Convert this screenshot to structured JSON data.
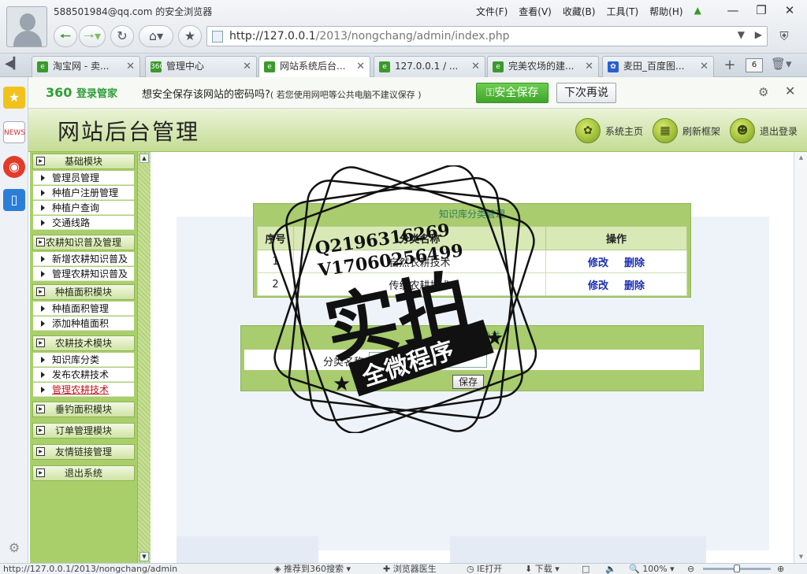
{
  "browser": {
    "profile_text": "588501984@qq.com 的安全浏览器",
    "menu": [
      "文件(F)",
      "查看(V)",
      "收藏(B)",
      "工具(T)",
      "帮助(H)"
    ],
    "url_host": "http://127.0.0.1",
    "url_path": "/2013/nongchang/admin/index.php",
    "tabs": [
      {
        "label": "淘宝网 - 卖...",
        "icon_color": "#3a9a2a",
        "active": false
      },
      {
        "label": "管理中心",
        "icon_color": "#3a9a2a",
        "icon_text": "360",
        "active": false
      },
      {
        "label": "网站系统后台...",
        "icon_color": "#3a9a2a",
        "active": true
      },
      {
        "label": "127.0.0.1 / ...",
        "icon_color": "#3a9a2a",
        "active": false
      },
      {
        "label": "完美农场的建...",
        "icon_color": "#3a9a2a",
        "active": false
      },
      {
        "label": "麦田_百度图...",
        "icon_color": "#2a5fd0",
        "active": false
      }
    ],
    "tab_count": "6"
  },
  "pwbar": {
    "brand": "360",
    "brand_suffix": "登录管家",
    "message": "想安全保存该网站的密码吗?",
    "note": "( 若您使用网吧等公共电脑不建议保存 )",
    "save_label": "安全保存",
    "later_label": "下次再说"
  },
  "admin": {
    "title": "网站后台管理",
    "links": [
      "系统主页",
      "刷新框架",
      "退出登录"
    ]
  },
  "menu": {
    "sections": [
      {
        "title": "基础模块",
        "items": [
          "管理员管理",
          "种植户注册管理",
          "种植户查询",
          "交通线路"
        ]
      },
      {
        "title": "农耕知识普及管理",
        "items": [
          "新增农耕知识普及",
          "管理农耕知识普及"
        ]
      },
      {
        "title": "种植面积模块",
        "items": [
          "种植面积管理",
          "添加种植面积"
        ]
      },
      {
        "title": "农耕技术模块",
        "items": [
          "知识库分类",
          "发布农耕技术",
          "管理农耕技术"
        ]
      },
      {
        "title": "垂钓面积模块",
        "items": []
      },
      {
        "title": "订单管理模块",
        "items": []
      },
      {
        "title": "友情链接管理",
        "items": []
      },
      {
        "title": "退出系统",
        "items": []
      }
    ]
  },
  "category": {
    "title": "知识库分类管理",
    "headers": [
      "序号",
      "分类名称",
      "操作"
    ],
    "rows": [
      {
        "no": "1",
        "name": "自然农耕技术"
      },
      {
        "no": "2",
        "name": "传统农耕技术"
      }
    ],
    "edit_label": "修改",
    "delete_label": "删除"
  },
  "add_form": {
    "title": "添加知识分类",
    "label": "分类名称",
    "value": "",
    "save_label": "保存"
  },
  "watermark": {
    "line1": "Q2196316269",
    "line2": "V17060256499",
    "big": "实拍",
    "band": "全微程序"
  },
  "status": {
    "url": "http://127.0.0.1/2013/nongchang/admin",
    "items": [
      "推荐到360搜索",
      "浏览器医生",
      "IE打开",
      "下载"
    ],
    "zoom": "100%",
    "zoom_level": 0.5
  }
}
